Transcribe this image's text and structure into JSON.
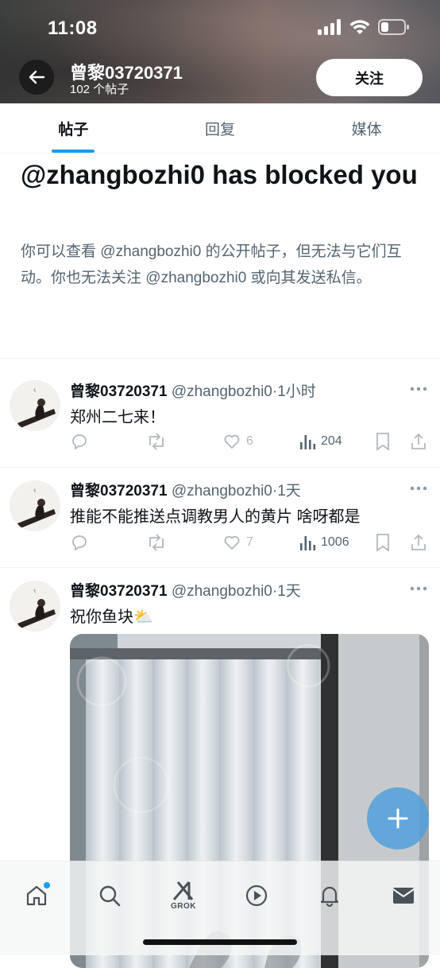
{
  "status_bar": {
    "time": "11:08"
  },
  "header": {
    "display_name": "曾黎03720371",
    "post_count": "102 个帖子",
    "follow_label": "关注"
  },
  "tabs": [
    {
      "label": "帖子",
      "active": true
    },
    {
      "label": "回复",
      "active": false
    },
    {
      "label": "媒体",
      "active": false
    }
  ],
  "blocked": {
    "title": "@zhangbozhi0 has blocked you",
    "body": "你可以查看 @zhangbozhi0 的公开帖子，但无法与它们互动。你也无法关注 @zhangbozhi0 或向其发送私信。"
  },
  "posts": [
    {
      "name": "曾黎03720371",
      "handle": "@zhangbozhi0",
      "time": "·1小时",
      "text": "郑州二七来！",
      "likes": "6",
      "views": "204"
    },
    {
      "name": "曾黎03720371",
      "handle": "@zhangbozhi0",
      "time": "·1天",
      "text": "推能不能推送点调教男人的黄片 啥呀都是",
      "likes": "7",
      "views": "1006"
    },
    {
      "name": "曾黎03720371",
      "handle": "@zhangbozhi0",
      "time": "·1天",
      "text": "祝你鱼块⛅"
    }
  ],
  "bottom_nav": {
    "grok_label": "GROK"
  },
  "colors": {
    "accent": "#1d9bf0",
    "text_primary": "#0f1419",
    "text_secondary": "#536471"
  }
}
